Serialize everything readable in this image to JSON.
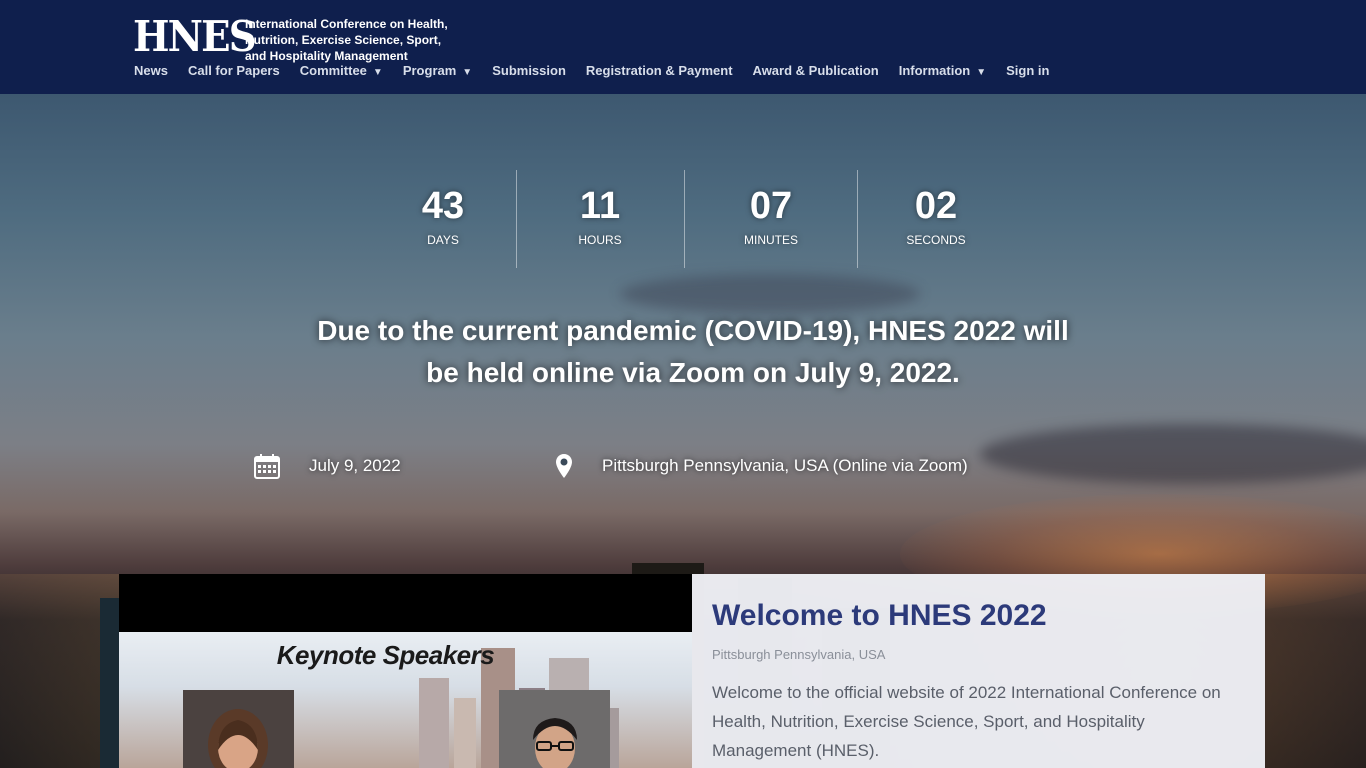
{
  "header": {
    "logo_text": "HNES",
    "logo_subtitle_line1": "International Conference on Health,",
    "logo_subtitle_line2": "Nutrition, Exercise Science, Sport,",
    "logo_subtitle_line3": "and Hospitality Management",
    "nav": [
      {
        "label": "News",
        "dropdown": false
      },
      {
        "label": "Call for Papers",
        "dropdown": false
      },
      {
        "label": "Committee",
        "dropdown": true
      },
      {
        "label": "Program",
        "dropdown": true
      },
      {
        "label": "Submission",
        "dropdown": false
      },
      {
        "label": "Registration & Payment",
        "dropdown": false
      },
      {
        "label": "Award & Publication",
        "dropdown": false
      },
      {
        "label": "Information",
        "dropdown": true
      },
      {
        "label": "Sign in",
        "dropdown": false
      }
    ],
    "caret": "▼"
  },
  "countdown": {
    "days": {
      "value": "43",
      "label": "DAYS"
    },
    "hours": {
      "value": "11",
      "label": "HOURS"
    },
    "minutes": {
      "value": "07",
      "label": "MINUTES"
    },
    "seconds": {
      "value": "02",
      "label": "SECONDS"
    }
  },
  "notice": {
    "line1": "Due to the current pandemic (COVID-19), HNES 2022 will",
    "line2": "be held online via Zoom on July 9, 2022."
  },
  "event_info": {
    "date": "July 9, 2022",
    "location": "Pittsburgh Pennsylvania, USA (Online via Zoom)"
  },
  "keynote": {
    "title": "Keynote Speakers"
  },
  "welcome": {
    "title": "Welcome to HNES 2022",
    "subtitle": "Pittsburgh Pennsylvania, USA",
    "body": "Welcome to the official website of 2022 International Conference on Health, Nutrition, Exercise Science, Sport, and Hospitality Management (HNES)."
  },
  "colors": {
    "header_bg": "#0f1f4d",
    "welcome_title": "#2c3a7a",
    "panel_bg": "#eef0f5"
  }
}
